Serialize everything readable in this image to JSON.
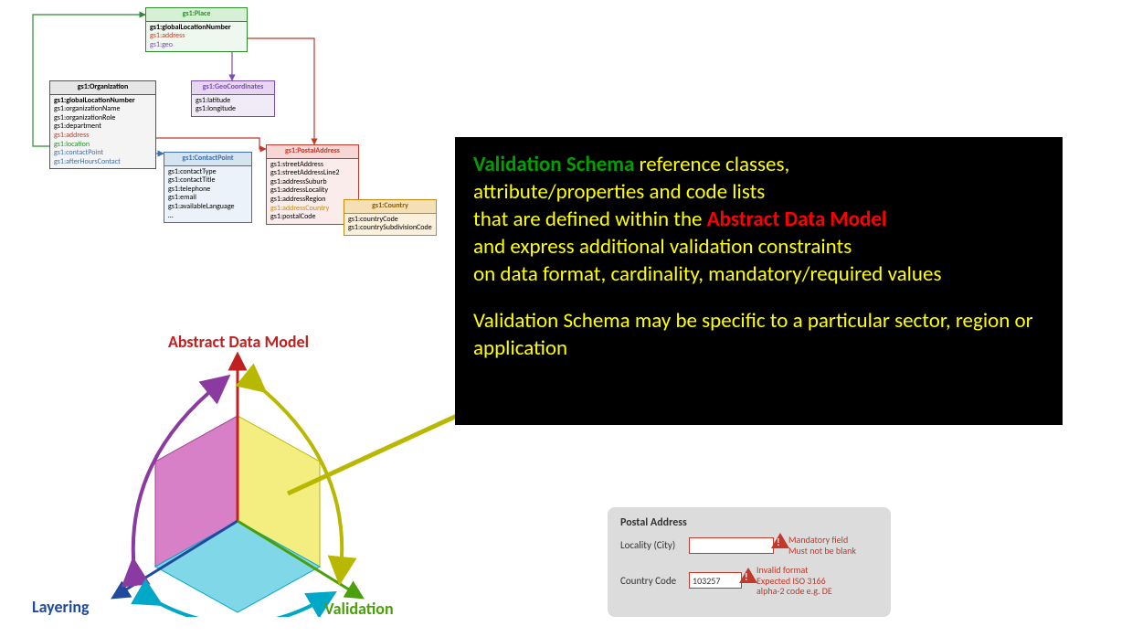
{
  "uml": {
    "place": {
      "title": "gs1:Place",
      "props": [
        "gs1:globalLocationNumber",
        "gs1:address",
        "gs1:geo"
      ],
      "propColors": [
        "#000",
        "#c0392b",
        "#7a4bb5"
      ]
    },
    "org": {
      "title": "gs1:Organization",
      "props": [
        "gs1:globalLocationNumber",
        "gs1:organizationName",
        "gs1:organizationRole",
        "gs1:department",
        "gs1:address",
        "gs1:location",
        "gs1:contactPoint",
        "gs1:afterHoursContact"
      ],
      "propColors": [
        "#000",
        "#555",
        "#555",
        "#555",
        "#c0392b",
        "#2e8b2e",
        "#3b6fb5",
        "#3b6fb5"
      ]
    },
    "geo": {
      "title": "gs1:GeoCoordinates",
      "props": [
        "gs1:latitude",
        "gs1:longitude"
      ]
    },
    "contact": {
      "title": "gs1:ContactPoint",
      "props": [
        "gs1:contactType",
        "gs1:contactTitle",
        "gs1:telephone",
        "gs1:email",
        "gs1:availableLanguage",
        "…"
      ]
    },
    "postal": {
      "title": "gs1:PostalAddress",
      "props": [
        "gs1:streetAddress",
        "gs1:streetAddressLine2",
        "gs1:addressSuburb",
        "gs1:addressLocality",
        "gs1:addressRegion",
        "gs1:addressCountry",
        "gs1:postalCode"
      ],
      "propColors": [
        "#555",
        "#555",
        "#555",
        "#555",
        "#555",
        "#c58a10",
        "#555"
      ]
    },
    "country": {
      "title": "gs1:Country",
      "props": [
        "gs1:countryCode",
        "gs1:countrySubdivisionCode"
      ]
    }
  },
  "axisLabels": {
    "adm": "Abstract Data Model",
    "layering": "Layering",
    "validation": "Validation"
  },
  "panel": {
    "s1": "Validation Schema",
    "s2": " reference classes,",
    "l2": "attribute/properties and code lists",
    "l3a": "that are defined within the ",
    "l3b": "Abstract Data Model",
    "l4": "and express additional validation constraints",
    "l5": "on data format, cardinality, mandatory/required values",
    "l7": "Validation Schema may be specific to a particular sector, region or application"
  },
  "form": {
    "title": "Postal Address",
    "row1": {
      "label": "Locality (City)",
      "value": "",
      "err1": "Mandatory field",
      "err2": "Must not be blank"
    },
    "row2": {
      "label": "Country Code",
      "value": "103257",
      "err1": "Invalid format",
      "err2": "Expected ISO 3166",
      "err3": "alpha-2 code e.g. DE"
    }
  }
}
